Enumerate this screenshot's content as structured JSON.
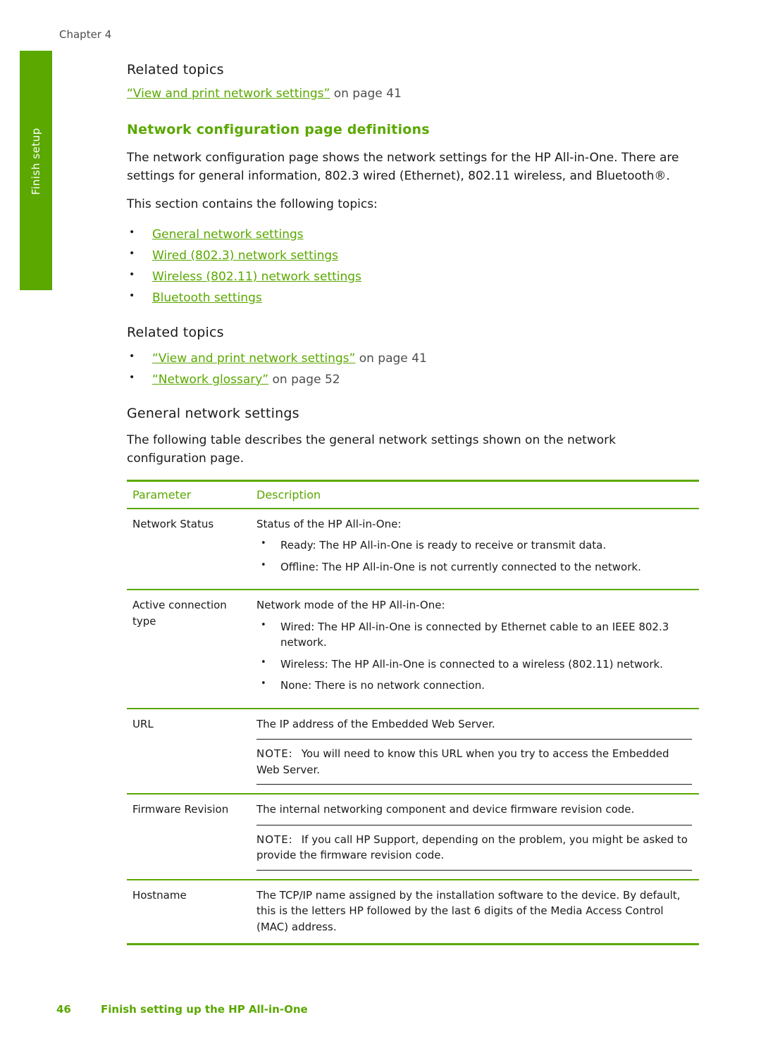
{
  "page": {
    "chapter": "Chapter 4",
    "side_tab": "Finish setup",
    "footer_page_number": "46",
    "footer_title": "Finish setting up the HP All-in-One",
    "accent_color": "#5aa800"
  },
  "section_top": {
    "related_heading": "Related topics",
    "related_link": "“View and print network settings”",
    "related_link_suffix": " on page 41"
  },
  "section_main": {
    "heading": "Network configuration page definitions",
    "paragraph1": "The network configuration page shows the network settings for the HP All-in-One. There are settings for general information, 802.3 wired (Ethernet), 802.11 wireless, and Bluetooth®.",
    "paragraph2": "This section contains the following topics:",
    "topics": [
      "General network settings",
      "Wired (802.3) network settings",
      "Wireless (802.11) network settings",
      "Bluetooth settings"
    ],
    "related_heading": "Related topics",
    "related_items": [
      {
        "link": "“View and print network settings”",
        "suffix": " on page 41"
      },
      {
        "link": "“Network glossary”",
        "suffix": " on page 52"
      }
    ]
  },
  "general_network_settings": {
    "heading": "General network settings",
    "intro": "The following table describes the general network settings shown on the network configuration page.",
    "table": {
      "headers": [
        "Parameter",
        "Description"
      ],
      "rows": [
        {
          "parameter": "Network Status",
          "lead": "Status of the HP All-in-One:",
          "bullets": [
            "Ready: The HP All-in-One is ready to receive or transmit data.",
            "Offline: The HP All-in-One is not currently connected to the network."
          ]
        },
        {
          "parameter": "Active connection type",
          "lead": "Network mode of the HP All-in-One:",
          "bullets": [
            "Wired: The HP All-in-One is connected by Ethernet cable to an IEEE 802.3 network.",
            "Wireless: The HP All-in-One is connected to a wireless (802.11) network.",
            "None: There is no network connection."
          ]
        },
        {
          "parameter": "URL",
          "lead": "The IP address of the Embedded Web Server.",
          "note_label": "NOTE:",
          "note_text": "You will need to know this URL when you try to access the Embedded Web Server."
        },
        {
          "parameter": "Firmware Revision",
          "lead": "The internal networking component and device firmware revision code.",
          "note_label": "NOTE:",
          "note_text": "If you call HP Support, depending on the problem, you might be asked to provide the firmware revision code."
        },
        {
          "parameter": "Hostname",
          "lead": "The TCP/IP name assigned by the installation software to the device. By default, this is the letters HP followed by the last 6 digits of the Media Access Control (MAC) address."
        }
      ]
    }
  }
}
